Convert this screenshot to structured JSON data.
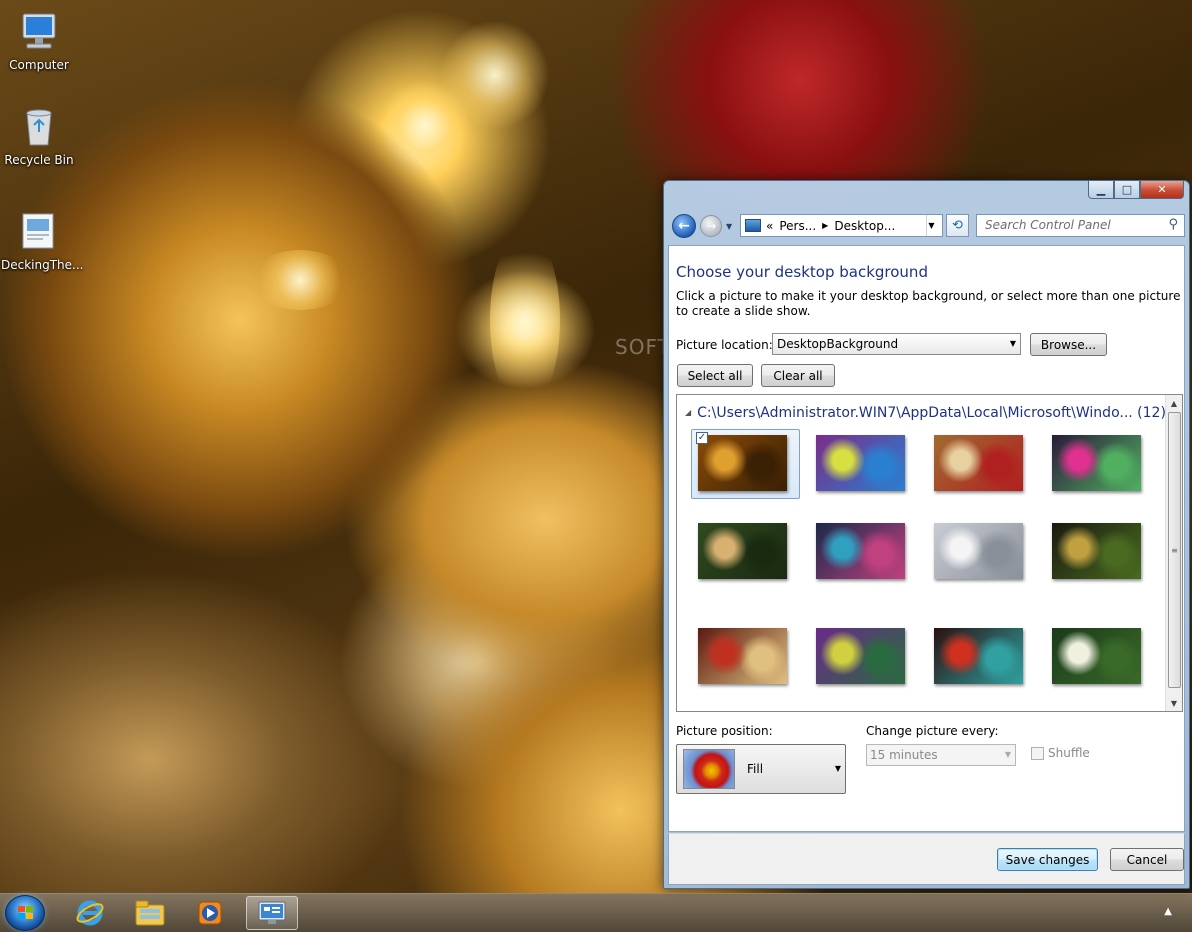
{
  "desktop": {
    "icons": [
      {
        "label": "Computer",
        "icon": "computer-icon"
      },
      {
        "label": "Recycle Bin",
        "icon": "recycle-bin-icon"
      },
      {
        "label": "DeckingThe...",
        "icon": "theme-file-icon"
      }
    ],
    "watermark": "SOFTPEDIA"
  },
  "window": {
    "caption_buttons": {
      "minimize": "minimize-icon",
      "maximize": "maximize-icon",
      "close": "close-icon"
    },
    "breadcrumb": {
      "overflow": "«",
      "items": [
        "Pers...",
        "Desktop..."
      ]
    },
    "search_placeholder": "Search Control Panel",
    "heading": "Choose your desktop background",
    "description": "Click a picture to make it your desktop background, or select more than one picture to create a slide show.",
    "picture_location_label": "Picture location:",
    "picture_location_value": "DesktopBackground",
    "browse_label": "Browse...",
    "select_all_label": "Select all",
    "clear_all_label": "Clear all",
    "group_header": "C:\\Users\\Administrator.WIN7\\AppData\\Local\\Microsoft\\Windo... (12)",
    "thumbnails": [
      {
        "selected": true,
        "checked": "✓",
        "colors": [
          "#8a4a08",
          "#e0a030",
          "#3a2004"
        ]
      },
      {
        "selected": false,
        "colors": [
          "#7a2d8a",
          "#d7e040",
          "#2a7fd0"
        ]
      },
      {
        "selected": false,
        "colors": [
          "#a06a30",
          "#e8d0a0",
          "#b02020"
        ]
      },
      {
        "selected": false,
        "colors": [
          "#2a1a3a",
          "#e03090",
          "#50b060"
        ]
      },
      {
        "selected": false,
        "colors": [
          "#304a20",
          "#d8b070",
          "#1a2a10"
        ]
      },
      {
        "selected": false,
        "colors": [
          "#1a2a4a",
          "#30a0c0",
          "#c04080"
        ]
      },
      {
        "selected": false,
        "colors": [
          "#c8ccd4",
          "#f4f4f6",
          "#8a909a"
        ]
      },
      {
        "selected": false,
        "colors": [
          "#1a1a10",
          "#c0a040",
          "#4a6a20"
        ]
      },
      {
        "selected": false,
        "colors": [
          "#5a1a10",
          "#c03020",
          "#e0c080"
        ]
      },
      {
        "selected": false,
        "colors": [
          "#6a2a8a",
          "#d0d040",
          "#2a6a40"
        ]
      },
      {
        "selected": false,
        "colors": [
          "#2a1010",
          "#d03020",
          "#30a0a0"
        ]
      },
      {
        "selected": false,
        "colors": [
          "#1a3a1a",
          "#f0f0e0",
          "#3a6a2a"
        ]
      }
    ],
    "picture_position_label": "Picture position:",
    "picture_position_value": "Fill",
    "change_picture_label": "Change picture every:",
    "change_picture_value": "15 minutes",
    "shuffle_label": "Shuffle",
    "save_label": "Save changes",
    "cancel_label": "Cancel"
  },
  "taskbar": {
    "items": [
      "start-orb",
      "internet-explorer-icon",
      "windows-explorer-icon",
      "media-player-icon",
      "personalization-icon"
    ],
    "active": "personalization-icon",
    "tray_arrow": "▲"
  },
  "colors": {
    "heading": "#1e3287",
    "window_frame": "#b9d1ea"
  }
}
